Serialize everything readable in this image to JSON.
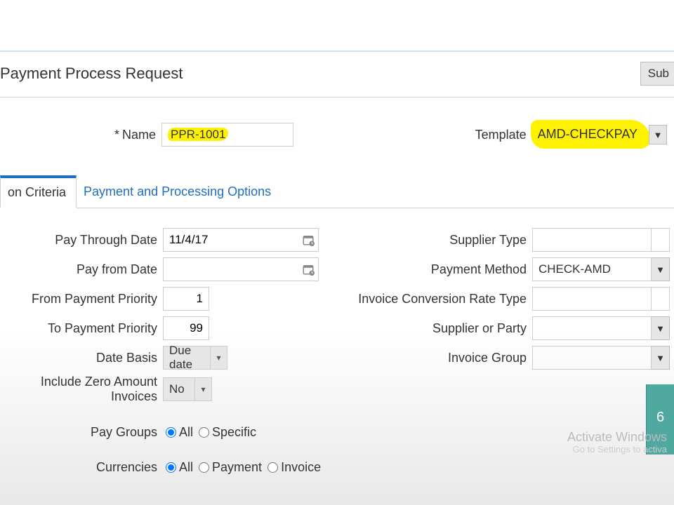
{
  "header": {
    "title": "Payment Process Request",
    "submit_label": "Sub"
  },
  "top_form": {
    "name_label": "Name",
    "name_value": "PPR-1001",
    "template_label": "Template",
    "template_value": "AMD-CHECKPAY"
  },
  "tabs": {
    "active": "on Criteria",
    "other": "Payment and Processing Options"
  },
  "criteria": {
    "pay_through_date_label": "Pay Through Date",
    "pay_through_date_value": "11/4/17",
    "pay_from_date_label": "Pay from Date",
    "pay_from_date_value": "",
    "from_priority_label": "From Payment Priority",
    "from_priority_value": "1",
    "to_priority_label": "To Payment Priority",
    "to_priority_value": "99",
    "date_basis_label": "Date Basis",
    "date_basis_value": "Due date",
    "zero_amount_label": "Include Zero Amount Invoices",
    "zero_amount_value": "No",
    "pay_groups_label": "Pay Groups",
    "pay_groups_options": {
      "all": "All",
      "specific": "Specific"
    },
    "pay_groups_selected": "all",
    "currencies_label": "Currencies",
    "currencies_options": {
      "all": "All",
      "payment": "Payment",
      "invoice": "Invoice"
    },
    "currencies_selected": "all",
    "supplier_type_label": "Supplier Type",
    "supplier_type_value": "",
    "payment_method_label": "Payment Method",
    "payment_method_value": "CHECK-AMD",
    "conv_rate_label": "Invoice Conversion Rate Type",
    "conv_rate_value": "",
    "supplier_party_label": "Supplier or Party",
    "supplier_party_value": "",
    "invoice_group_label": "Invoice Group",
    "invoice_group_value": ""
  },
  "watermark": {
    "line1": "Activate Windows",
    "line2": "Go to Settings to activa"
  },
  "teal_badge": "6"
}
